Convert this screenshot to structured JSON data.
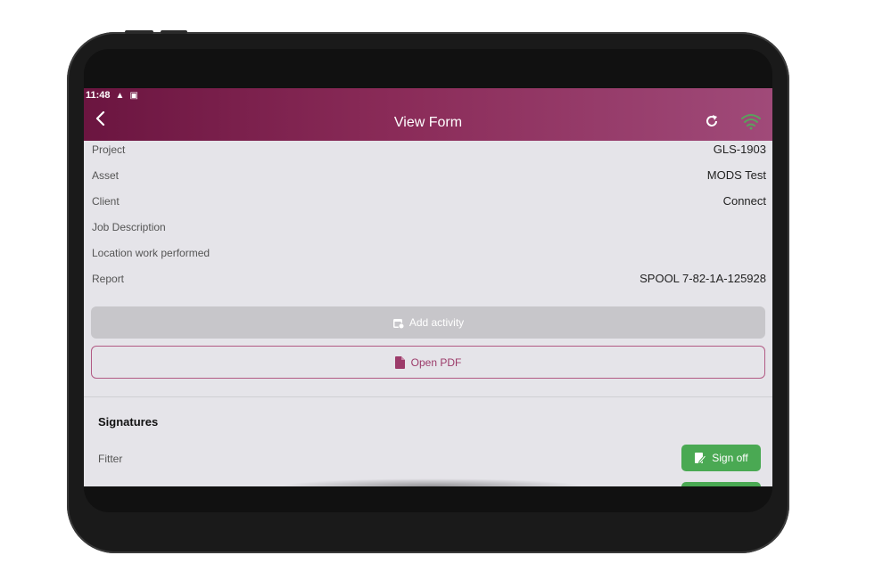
{
  "status_bar": {
    "time": "11:48",
    "icons": [
      "warning-icon",
      "sim-icon"
    ]
  },
  "app_bar": {
    "title": "View Form",
    "icons": [
      "back-chevron-icon",
      "refresh-icon",
      "wifi-icon"
    ]
  },
  "fields": [
    {
      "label": "Project",
      "value": "GLS-1903"
    },
    {
      "label": "Asset",
      "value": "MODS Test"
    },
    {
      "label": "Client",
      "value": "Connect"
    },
    {
      "label": "Job Description",
      "value": ""
    },
    {
      "label": "Location work performed",
      "value": ""
    },
    {
      "label": "Report",
      "value": "SPOOL 7-82-1A-125928"
    }
  ],
  "actions": {
    "add_activity": "Add activity",
    "open_pdf": "Open PDF"
  },
  "signatures": {
    "title": "Signatures",
    "items": [
      {
        "role": "Fitter",
        "button": "Sign off"
      }
    ]
  },
  "colors": {
    "accent": "#8a2b58",
    "success": "#4aa953",
    "disabled": "#c7c6ca"
  }
}
